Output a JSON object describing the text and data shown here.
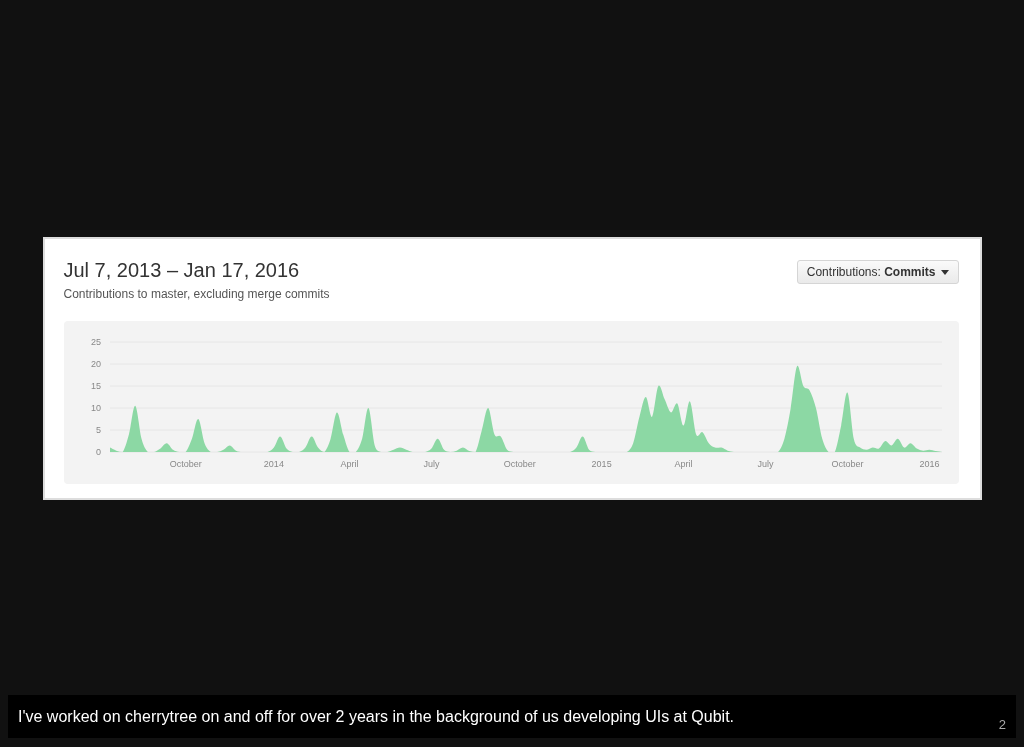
{
  "card": {
    "title": "Jul 7, 2013 – Jan 17, 2016",
    "subtitle": "Contributions to master, excluding merge commits",
    "dropdown": {
      "label": "Contributions: **Commits**"
    },
    "chart_data": {
      "type": "area",
      "ylim": [
        0,
        25
      ],
      "grid": true,
      "yticks": [
        0,
        5,
        10,
        15,
        20,
        25
      ],
      "categories": [
        null,
        null,
        null,
        null,
        null,
        null,
        null,
        null,
        null,
        null,
        null,
        null,
        "October",
        null,
        null,
        null,
        null,
        null,
        null,
        null,
        null,
        null,
        null,
        null,
        null,
        null,
        "2014",
        null,
        null,
        null,
        null,
        null,
        null,
        null,
        null,
        null,
        null,
        null,
        "April",
        null,
        null,
        null,
        null,
        null,
        null,
        null,
        null,
        null,
        null,
        null,
        null,
        "July",
        null,
        null,
        null,
        null,
        null,
        null,
        null,
        null,
        null,
        null,
        null,
        null,
        null,
        "October",
        null,
        null,
        null,
        null,
        null,
        null,
        null,
        null,
        null,
        null,
        null,
        null,
        "2015",
        null,
        null,
        null,
        null,
        null,
        null,
        null,
        null,
        null,
        null,
        null,
        null,
        "April",
        null,
        null,
        null,
        null,
        null,
        null,
        null,
        null,
        null,
        null,
        null,
        null,
        "July",
        null,
        null,
        null,
        null,
        null,
        null,
        null,
        null,
        null,
        null,
        null,
        null,
        "October",
        null,
        null,
        null,
        null,
        null,
        null,
        null,
        null,
        null,
        null,
        null,
        null,
        "2016",
        null,
        null
      ],
      "series": [
        {
          "color": "#8cd8a4",
          "values": [
            1,
            0.3,
            0,
            4,
            10.5,
            3,
            0,
            0,
            0.8,
            2,
            0.5,
            0,
            0,
            3,
            7.5,
            2,
            0,
            0,
            0.5,
            1.5,
            0.3,
            0,
            0,
            0,
            0,
            0,
            1,
            3.5,
            0.8,
            0,
            0,
            1,
            3.5,
            1,
            0,
            3,
            9,
            4,
            0,
            0,
            3,
            10,
            1.5,
            0,
            0,
            0.5,
            1,
            0.5,
            0,
            0,
            0,
            0.8,
            3,
            0.5,
            0,
            0.3,
            1,
            0.2,
            0,
            5,
            10,
            4,
            3.5,
            0.5,
            0,
            0,
            0,
            0,
            0,
            0,
            0,
            0,
            0,
            0,
            1,
            3.5,
            0.5,
            0,
            0,
            0,
            0,
            0,
            0,
            2,
            8,
            12.5,
            8,
            15,
            12,
            9,
            11,
            6,
            11.5,
            4,
            4.5,
            2,
            1,
            1,
            0.3,
            0,
            0,
            0,
            0,
            0,
            0,
            0,
            0,
            3,
            10,
            19.5,
            15,
            14,
            10,
            3,
            0,
            0,
            6,
            13.5,
            3,
            1,
            0.5,
            1,
            0.8,
            2.5,
            1.5,
            3,
            1,
            2,
            0.8,
            0.3,
            0.5,
            0.2,
            0
          ]
        }
      ]
    }
  },
  "caption": "I've worked on cherrytree on and off for over 2 years in the background of us developing UIs at Qubit.",
  "slide_number": "2"
}
